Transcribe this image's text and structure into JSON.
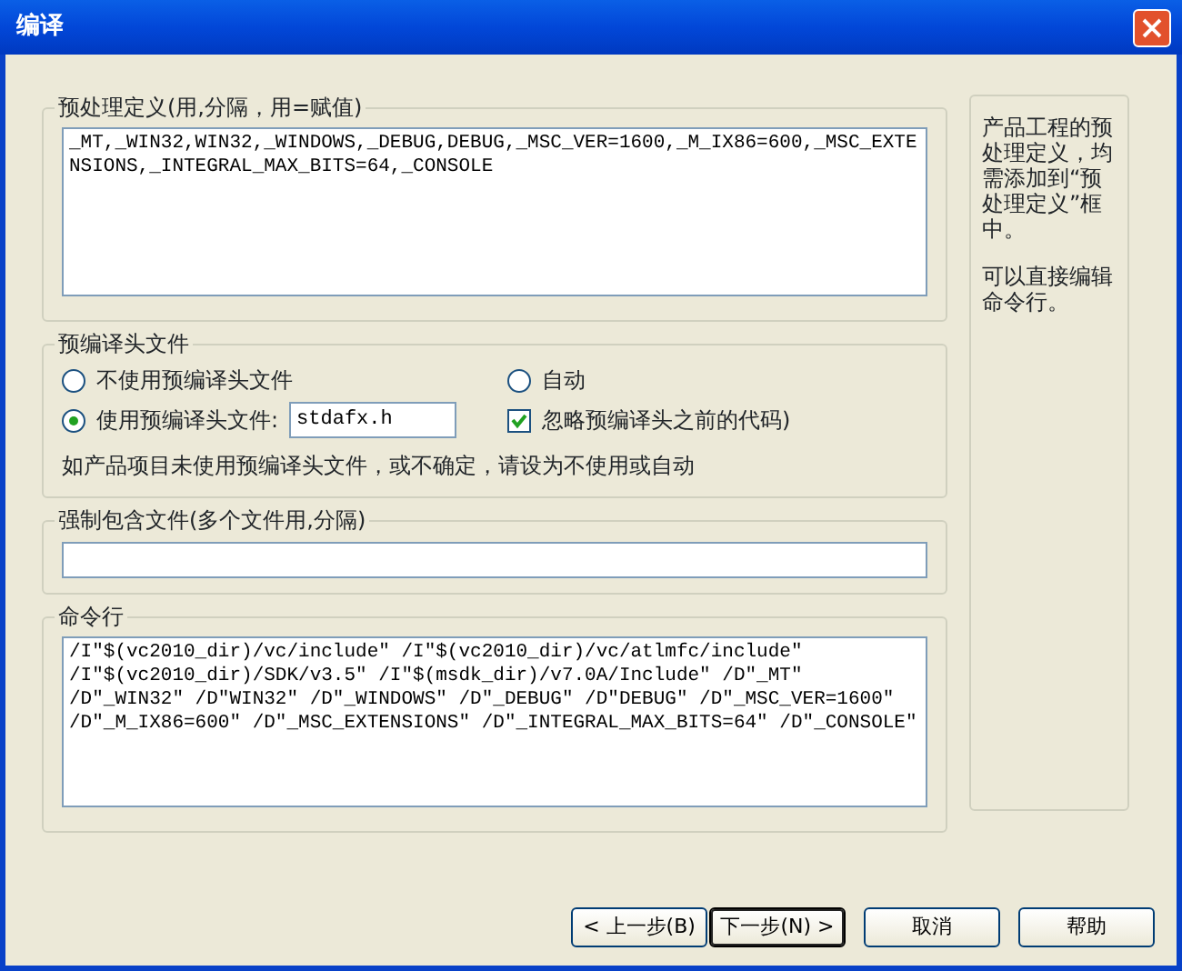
{
  "window": {
    "title": "编译"
  },
  "preprocessor": {
    "legend": "预处理定义(用,分隔，用=赋值)",
    "value": "_MT,_WIN32,WIN32,_WINDOWS,_DEBUG,DEBUG,_MSC_VER=1600,_M_IX86=600,_MSC_EXTENSIONS,_INTEGRAL_MAX_BITS=64,_CONSOLE"
  },
  "precompiled_header": {
    "legend": "预编译头文件",
    "options": [
      {
        "label": "不使用预编译头文件",
        "selected": false
      },
      {
        "label": "自动",
        "selected": false
      },
      {
        "label": "使用预编译头文件:",
        "selected": true
      }
    ],
    "header_file": "stdafx.h",
    "ignore_before": {
      "label": "忽略预编译头之前的代码)",
      "checked": true
    },
    "note": "如产品项目未使用预编译头文件，或不确定，请设为不使用或自动"
  },
  "forced_include": {
    "legend": "强制包含文件(多个文件用,分隔)"
  },
  "command_line": {
    "legend": "命令行",
    "value": "/I\"$(vc2010_dir)/vc/include\" /I\"$(vc2010_dir)/vc/atlmfc/include\" /I\"$(vc2010_dir)/SDK/v3.5\" /I\"$(msdk_dir)/v7.0A/Include\" /D\"_MT\" /D\"_WIN32\" /D\"WIN32\" /D\"_WINDOWS\" /D\"_DEBUG\" /D\"DEBUG\" /D\"_MSC_VER=1600\" /D\"_M_IX86=600\" /D\"_MSC_EXTENSIONS\" /D\"_INTEGRAL_MAX_BITS=64\" /D\"_CONSOLE\""
  },
  "help_panel": {
    "paragraphs": [
      "产品工程的预处理定义，均需添加到“预处理定义”框中。",
      "可以直接编辑命令行。"
    ]
  },
  "buttons": [
    {
      "label": "< 上一步(B)",
      "default": false
    },
    {
      "label": "下一步(N) >",
      "default": true
    },
    {
      "label": "取消",
      "default": false
    },
    {
      "label": "帮助",
      "default": false
    }
  ]
}
